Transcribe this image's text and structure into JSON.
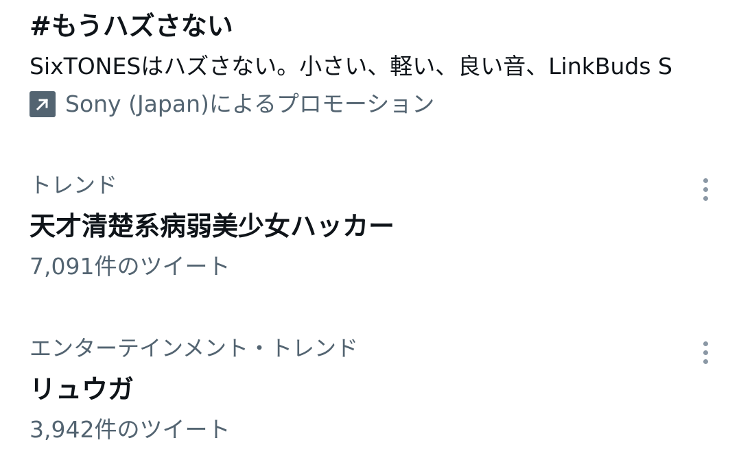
{
  "promoted": {
    "hashtag": "#もうハズさない",
    "description": "SixTONESはハズさない。小さい、軽い、良い音、LinkBuds S",
    "promoted_by": "Sony (Japan)によるプロモーション",
    "icon": "arrow-up-right-icon",
    "icon_color": "#536471"
  },
  "trends": [
    {
      "context": "トレンド",
      "name": "天才清楚系病弱美少女ハッカー",
      "tweet_count": "7,091件のツイート",
      "more_icon": "more-vertical-icon"
    },
    {
      "context": "エンターテインメント・トレンド",
      "name": "リュウガ",
      "tweet_count": "3,942件のツイート",
      "more_icon": "more-vertical-icon"
    }
  ],
  "colors": {
    "primary_text": "#0f1419",
    "secondary_text": "#536471",
    "dots": "#8b98a5",
    "background": "#ffffff"
  }
}
